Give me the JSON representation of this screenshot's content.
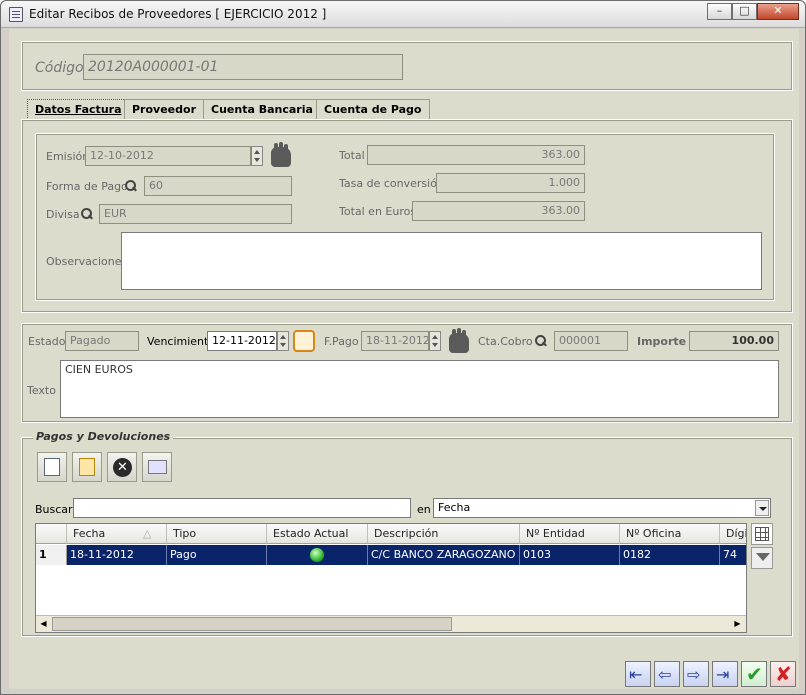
{
  "window": {
    "title": "Editar Recibos de Proveedores [ EJERCICIO 2012 ]",
    "minimize": "–",
    "maximize": "□",
    "close": "✕"
  },
  "codigo": {
    "label": "Código",
    "value": "20120A000001-01"
  },
  "tabs": [
    {
      "label": "Datos Factura"
    },
    {
      "label": "Proveedor"
    },
    {
      "label": "Cuenta Bancaria"
    },
    {
      "label": "Cuenta de Pago"
    }
  ],
  "factura": {
    "emision_label": "Emisión",
    "emision": "12-10-2012",
    "forma_pago_label": "Forma de Pago",
    "forma_pago": "60",
    "divisa_label": "Divisa",
    "divisa": "EUR",
    "observaciones_label": "Observaciones",
    "observaciones": "",
    "total_label": "Total",
    "total": "363.00",
    "tasa_label": "Tasa de conversión",
    "tasa": "1.000",
    "total_euros_label": "Total en Euros",
    "total_euros": "363.00"
  },
  "recibo": {
    "estado_label": "Estado",
    "estado": "Pagado",
    "vencimiento_label": "Vencimiento",
    "vencimiento": "12-11-2012",
    "fpago_label": "F.Pago",
    "fpago": "18-11-2012",
    "cta_cobro_label": "Cta.Cobro",
    "cta_cobro": "000001",
    "importe_label": "Importe",
    "importe": "100.00",
    "texto_label": "Texto",
    "texto": "CIEN EUROS"
  },
  "pagos": {
    "title": "Pagos y Devoluciones",
    "buscar_label": "Buscar",
    "buscar_value": "",
    "en_label": "en",
    "en_value": "Fecha",
    "columns": [
      "Fecha",
      "Tipo",
      "Estado Actual",
      "Descripción",
      "Nº Entidad",
      "Nº Oficina",
      "Dígit"
    ],
    "rows": [
      {
        "n": "1",
        "fecha": "18-11-2012",
        "tipo": "Pago",
        "descripcion": "C/C BANCO ZARAGOZANO",
        "entidad": "0103",
        "oficina": "0182",
        "digit": "74",
        "estado_color": "#2db52d"
      }
    ]
  },
  "colors": {
    "selection": "#0a246a",
    "accept": "#2a9a2a",
    "cancel": "#d02020",
    "nav": "#2a3f9e"
  }
}
